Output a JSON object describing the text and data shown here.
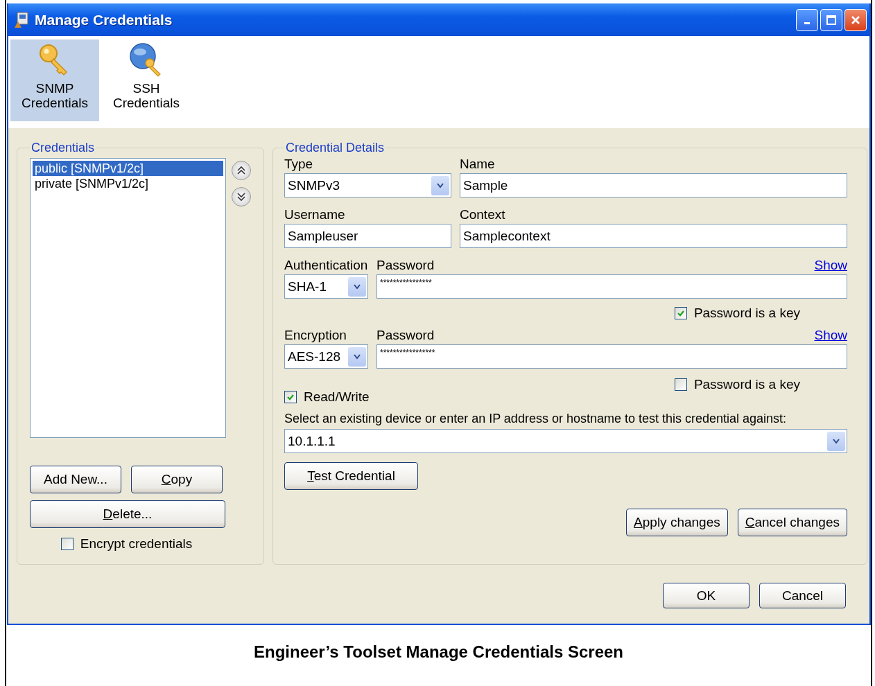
{
  "window": {
    "title": "Manage Credentials"
  },
  "toolbar": [
    {
      "kind": "snmp",
      "label": "SNMP Credentials",
      "selected": true
    },
    {
      "kind": "ssh",
      "label": "SSH Credentials",
      "selected": false
    }
  ],
  "credentials": {
    "title": "Credentials",
    "items": [
      {
        "label": "public [SNMPv1/2c]",
        "selected": true
      },
      {
        "label": "private [SNMPv1/2c]",
        "selected": false
      }
    ],
    "buttons": [
      {
        "label": "Add New...",
        "access_key": false
      },
      {
        "label": "Copy",
        "access_key": true
      },
      {
        "label": "Delete...",
        "access_key": true
      }
    ],
    "encrypt": {
      "label": "Encrypt credentials",
      "checked": false
    }
  },
  "details": {
    "title": "Credential Details",
    "type": {
      "label": "Type",
      "value": "SNMPv3"
    },
    "name": {
      "label": "Name",
      "value": "Sample"
    },
    "username": {
      "label": "Username",
      "value": "Sampleuser"
    },
    "context": {
      "label": "Context",
      "value": "Samplecontext"
    },
    "authentication": {
      "label": "Authentication",
      "value": "SHA-1",
      "password_label": "Password",
      "password": "****************",
      "show": "Show",
      "key": {
        "label": "Password is a key",
        "checked": true
      }
    },
    "encryption": {
      "label": "Encryption",
      "value": "AES-128",
      "password_label": "Password",
      "password": "*****************",
      "show": "Show",
      "key": {
        "label": "Password is a key",
        "checked": false
      }
    },
    "read_write": {
      "label": "Read/Write",
      "checked": true
    },
    "test_prompt": "Select an existing device or enter an IP address or hostname to test this credential against:",
    "test_target": "10.1.1.1",
    "test_button": {
      "label": "Test Credential",
      "access_key": true
    },
    "actions": [
      {
        "label": "Apply changes",
        "access_key": true
      },
      {
        "label": "Cancel changes",
        "access_key": true
      }
    ]
  },
  "buttons": [
    {
      "label": "OK",
      "access_key": false
    },
    {
      "label": "Cancel",
      "access_key": false
    }
  ],
  "caption": "Engineer’s Toolset Manage Credentials Screen"
}
